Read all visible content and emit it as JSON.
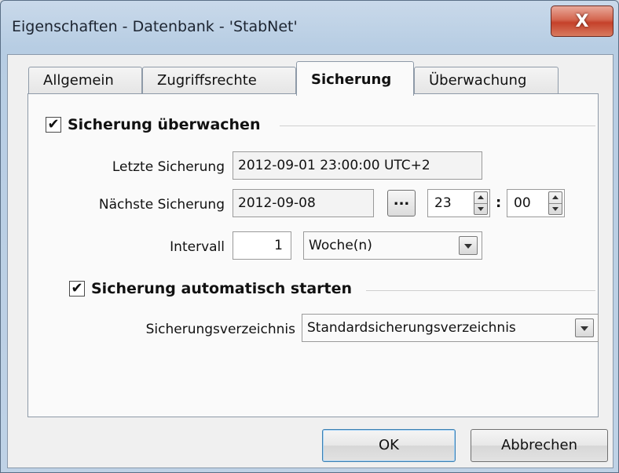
{
  "window": {
    "title": "Eigenschaften - Datenbank - 'StabNet'",
    "close_glyph": "X"
  },
  "tabs": [
    {
      "label": "Allgemein",
      "active": false
    },
    {
      "label": "Zugriffsrechte",
      "active": false
    },
    {
      "label": "Sicherung",
      "active": true
    },
    {
      "label": "Überwachung",
      "active": false
    }
  ],
  "backup_monitor": {
    "checked": true,
    "check_glyph": "✔",
    "label": "Sicherung überwachen",
    "last_label": "Letzte Sicherung",
    "last_value": "2012-09-01 23:00:00 UTC+2",
    "next_label": "Nächste Sicherung",
    "next_date": "2012-09-08",
    "date_picker_label": "...",
    "hour": "23",
    "time_separator": ":",
    "minute": "00",
    "interval_label": "Intervall",
    "interval_value": "1",
    "interval_unit": "Woche(n)"
  },
  "auto_start": {
    "checked": true,
    "check_glyph": "✔",
    "label": "Sicherung automatisch starten",
    "dir_label": "Sicherungsverzeichnis",
    "dir_value": "Standardsicherungsverzeichnis"
  },
  "buttons": {
    "ok": "OK",
    "cancel": "Abbrechen"
  }
}
